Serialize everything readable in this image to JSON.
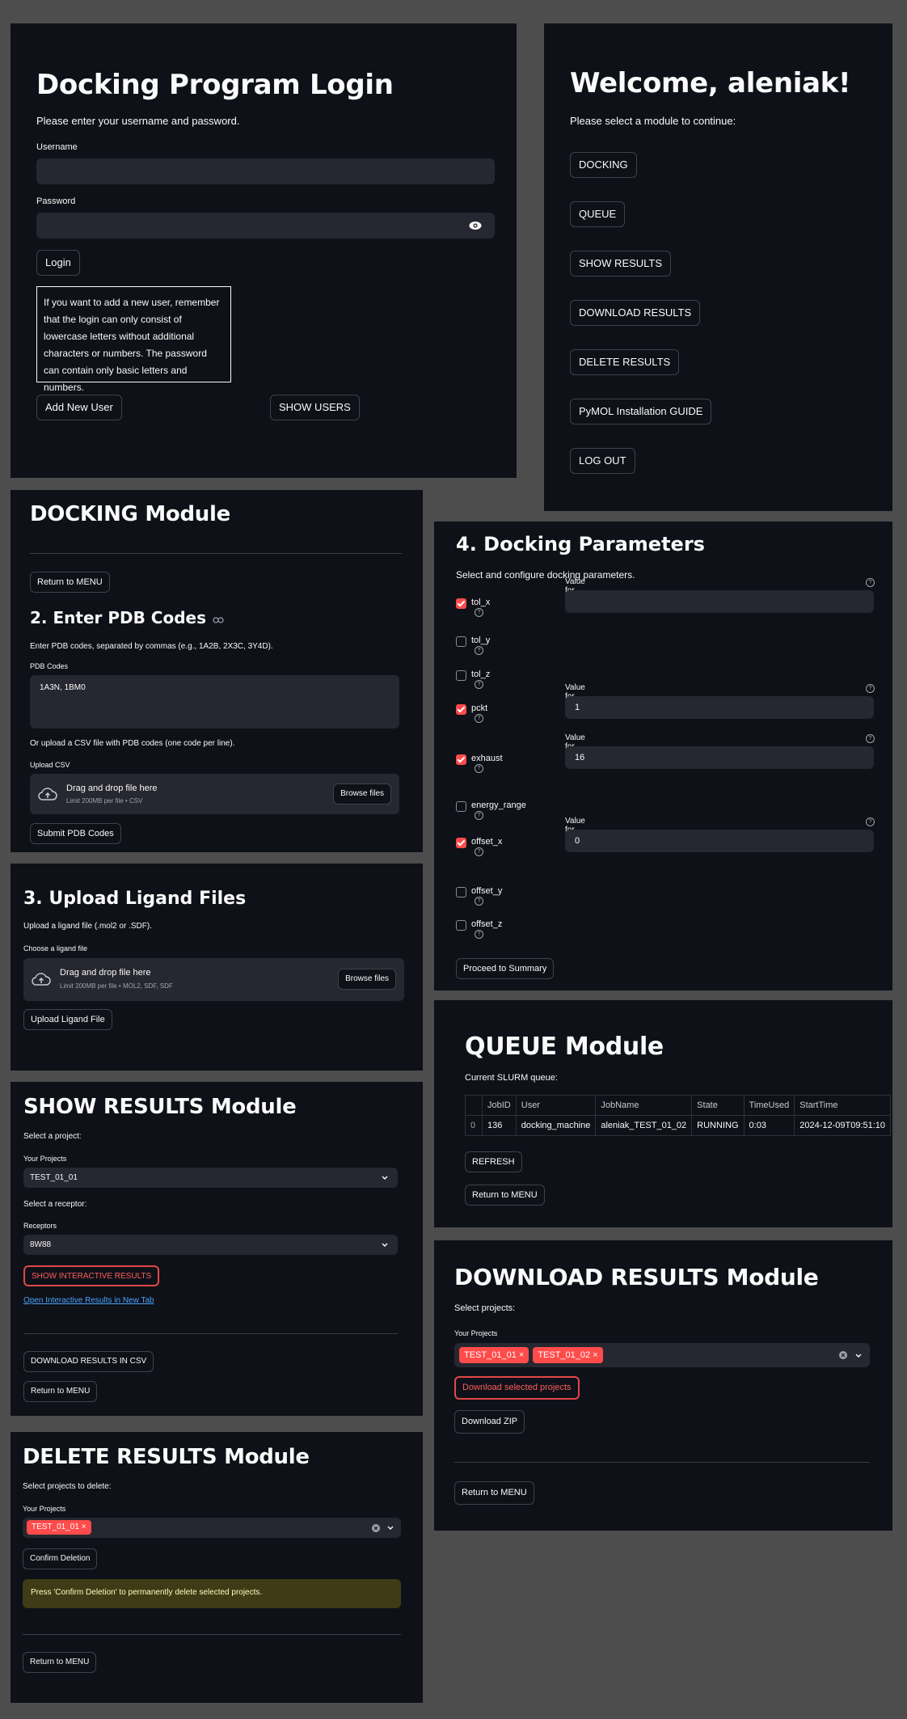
{
  "login": {
    "title": "Docking Program Login",
    "subtitle": "Please enter your username and password.",
    "username_label": "Username",
    "password_label": "Password",
    "login_button": "Login",
    "info_text": "If you want to add a new user, remember that the login can only consist of lowercase letters without additional characters or numbers. The password can contain only basic letters and numbers.",
    "add_user_button": "Add New User",
    "show_users_button": "SHOW USERS"
  },
  "welcome": {
    "title": "Welcome, aleniak!",
    "subtitle": "Please select a module to continue:",
    "buttons": [
      "DOCKING",
      "QUEUE",
      "SHOW RESULTS",
      "DOWNLOAD RESULTS",
      "DELETE RESULTS",
      "PyMOL Installation GUIDE",
      "LOG OUT"
    ]
  },
  "docking": {
    "title": "DOCKING Module",
    "return_button": "Return to MENU",
    "pdb_heading": "2. Enter PDB Codes",
    "pdb_help": "Enter PDB codes, separated by commas (e.g., 1A2B, 2X3C, 3Y4D).",
    "pdb_label": "PDB Codes",
    "pdb_value": "1A3N, 1BM0",
    "csv_help": "Or upload a CSV file with PDB codes (one code per line).",
    "csv_label": "Upload CSV",
    "drag_text": "Drag and drop file here",
    "csv_limit": "Limit 200MB per file • CSV",
    "browse_button": "Browse files",
    "submit_button": "Submit PDB Codes"
  },
  "ligand": {
    "title": "3. Upload Ligand Files",
    "help": "Upload a ligand file (.mol2 or .SDF).",
    "label": "Choose a ligand file",
    "drag_text": "Drag and drop file here",
    "limit": "Limit 200MB per file • MOL2, SDF, SDF",
    "browse_button": "Browse files",
    "upload_button": "Upload Ligand File"
  },
  "params": {
    "title": "4. Docking Parameters",
    "subtitle": "Select and configure docking parameters.",
    "items": [
      {
        "name": "tol_x",
        "checked": true,
        "value_label": "Value for tol_x",
        "value": ""
      },
      {
        "name": "tol_y",
        "checked": false
      },
      {
        "name": "tol_z",
        "checked": false
      },
      {
        "name": "pckt",
        "checked": true,
        "value_label": "Value for pckt",
        "value": "1"
      },
      {
        "name": "exhaust",
        "checked": true,
        "value_label": "Value for exhaust",
        "value": "16"
      },
      {
        "name": "energy_range",
        "checked": false
      },
      {
        "name": "offset_x",
        "checked": true,
        "value_label": "Value for offset_x",
        "value": "0"
      },
      {
        "name": "offset_y",
        "checked": false
      },
      {
        "name": "offset_z",
        "checked": false
      }
    ],
    "proceed_button": "Proceed to Summary"
  },
  "queue": {
    "title": "QUEUE Module",
    "subtitle": "Current SLURM queue:",
    "columns": [
      "",
      "JobID",
      "User",
      "JobName",
      "State",
      "TimeUsed",
      "StartTime"
    ],
    "rows": [
      [
        "0",
        "136",
        "docking_machine",
        "aleniak_TEST_01_02",
        "RUNNING",
        "0:03",
        "2024-12-09T09:51:10"
      ]
    ],
    "refresh_button": "REFRESH",
    "return_button": "Return to MENU"
  },
  "show_results": {
    "title": "SHOW RESULTS Module",
    "select_project": "Select a project:",
    "projects_label": "Your Projects",
    "project_value": "TEST_01_01",
    "select_receptor": "Select a receptor:",
    "receptors_label": "Receptors",
    "receptor_value": "8W88",
    "interactive_button": "SHOW INTERACTIVE RESULTS",
    "open_link": "Open Interactive Results in New Tab",
    "csv_button": "DOWNLOAD RESULTS IN CSV",
    "return_button": "Return to MENU"
  },
  "download": {
    "title": "DOWNLOAD RESULTS Module",
    "select_projects": "Select projects:",
    "projects_label": "Your Projects",
    "selected": [
      "TEST_01_01",
      "TEST_01_02"
    ],
    "download_selected_button": "Download selected projects",
    "zip_button": "Download ZIP",
    "return_button": "Return to MENU"
  },
  "delete": {
    "title": "DELETE RESULTS Module",
    "select_projects": "Select projects to delete:",
    "projects_label": "Your Projects",
    "selected": [
      "TEST_01_01"
    ],
    "confirm_button": "Confirm Deletion",
    "warning": "Press 'Confirm Deletion' to permanently delete selected projects.",
    "return_button": "Return to MENU"
  },
  "colors": {
    "background": "#0e1117",
    "page": "#4d4d4d",
    "accent": "#ff4b4b",
    "input": "#262730",
    "warning_bg": "#3e3b16",
    "warning_text": "#ffffc2"
  }
}
